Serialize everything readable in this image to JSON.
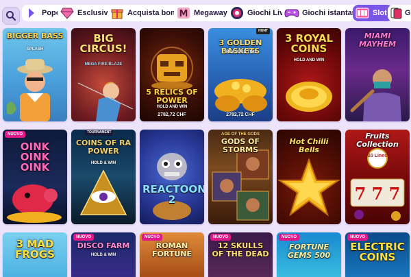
{
  "categories": [
    {
      "label": "Popolari",
      "icon": "popular-icon"
    },
    {
      "label": "Esclusivo",
      "icon": "diamond-icon"
    },
    {
      "label": "Acquista bonus",
      "icon": "gift-icon"
    },
    {
      "label": "Megaways",
      "icon": "megaways-icon"
    },
    {
      "label": "Giochi Live",
      "icon": "live-icon"
    },
    {
      "label": "Giochi istantanei",
      "icon": "gamepad-icon"
    },
    {
      "label": "Slot",
      "icon": "slot-icon",
      "active": true
    },
    {
      "label": "Gi",
      "icon": "cards-icon"
    }
  ],
  "games": [
    {
      "title": "BIGGER BASS",
      "sub": "SPLASH",
      "badge": "",
      "jackpot": ""
    },
    {
      "title": "BIG CIRCUS!",
      "sub": "MEGA FIRE BLAZE",
      "badge": "",
      "jackpot": ""
    },
    {
      "title": "5 RELICS OF POWER",
      "sub": "HOLD AND WIN",
      "badge": "",
      "jackpot": "2782,72 CHF"
    },
    {
      "title": "3 GOLDEN BASKETS",
      "sub": "TREASURE TIME",
      "badge": "",
      "jackpot": "2782,72 CHF",
      "topbadge": "HUNT"
    },
    {
      "title": "3 ROYAL COINS",
      "sub": "HOLD AND WIN",
      "badge": "",
      "jackpot": ""
    },
    {
      "title": "MIAMI MAYHEM",
      "sub": "",
      "badge": "",
      "jackpot": ""
    },
    {
      "title": "OINK OINK OINK",
      "sub": "",
      "badge": "NUOVO",
      "jackpot": ""
    },
    {
      "title": "COINS OF RA POWER",
      "sub": "HOLD & WIN",
      "badge": "",
      "jackpot": "",
      "topbadge": "TOURNAMENT"
    },
    {
      "title": "REACTOONZ 2",
      "sub": "",
      "badge": "",
      "jackpot": ""
    },
    {
      "title": "GODS OF STORMS",
      "sub": "AGE OF THE GODS",
      "badge": "",
      "jackpot": ""
    },
    {
      "title": "Hot Chilli Bells",
      "sub": "",
      "badge": "",
      "jackpot": ""
    },
    {
      "title": "Fruits Collection",
      "sub": "10 Lines",
      "badge": "",
      "jackpot": ""
    },
    {
      "title": "3 MAD FROGS",
      "sub": "",
      "badge": "",
      "jackpot": ""
    },
    {
      "title": "DISCO FARM",
      "sub": "HOLD & WIN",
      "badge": "NUOVO",
      "jackpot": ""
    },
    {
      "title": "ROMAN FORTUNE",
      "sub": "",
      "badge": "NUOVO",
      "jackpot": ""
    },
    {
      "title": "12 SKULLS OF THE DEAD",
      "sub": "",
      "badge": "NUOVO",
      "jackpot": ""
    },
    {
      "title": "FORTUNE GEMS 500",
      "sub": "",
      "badge": "NUOVO",
      "jackpot": ""
    },
    {
      "title": "ELECTRIC COINS",
      "sub": "",
      "badge": "NUOVO",
      "jackpot": ""
    }
  ],
  "colors": {
    "background": "#ede4fb",
    "accent": "#7a56e8",
    "new_badge": "#e0188a"
  }
}
